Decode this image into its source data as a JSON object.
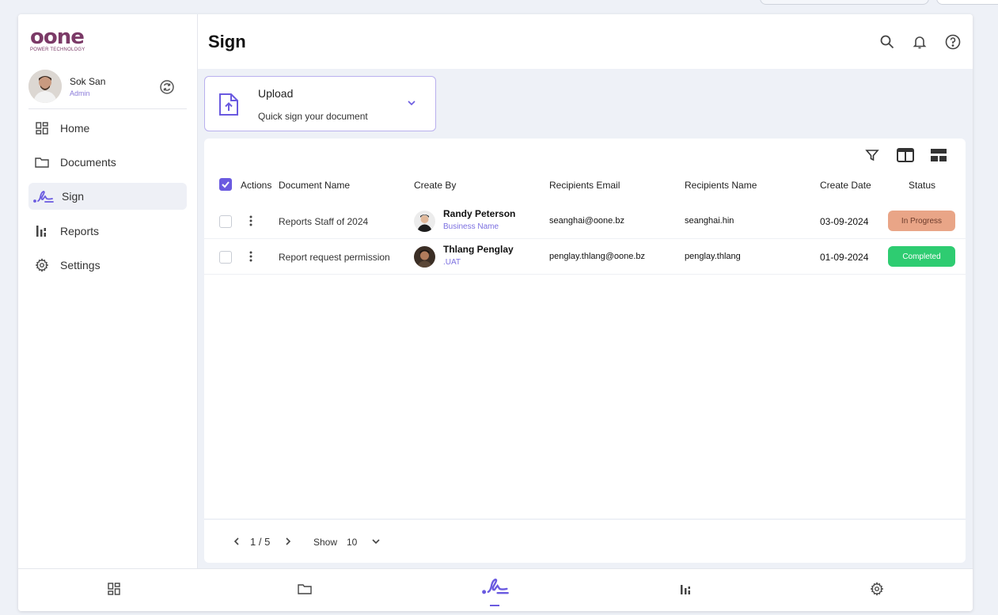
{
  "brand": {
    "logo_text": "oone",
    "tagline": "POWER TECHNOLOGY"
  },
  "user": {
    "name": "Sok San",
    "role": "Admin"
  },
  "sidebar": {
    "items": [
      {
        "label": "Home",
        "icon": "grid-icon"
      },
      {
        "label": "Documents",
        "icon": "folder-icon"
      },
      {
        "label": "Sign",
        "icon": "signature-icon",
        "active": true
      },
      {
        "label": "Reports",
        "icon": "bar-chart-icon"
      },
      {
        "label": "Settings",
        "icon": "gear-icon"
      }
    ]
  },
  "header": {
    "title": "Sign",
    "icons": [
      "search-icon",
      "bell-icon",
      "help-icon"
    ]
  },
  "upload": {
    "title": "Upload",
    "subtitle": "Quick sign your document"
  },
  "table": {
    "columns": [
      "Actions",
      "Document Name",
      "Create By",
      "Recipients Email",
      "Recipients Name",
      "Create Date",
      "Status"
    ],
    "rows": [
      {
        "document": "Reports Staff of 2024",
        "creator": "Randy Peterson",
        "creator_sub": "Business Name",
        "email": "seanghai@oone.bz",
        "recipient": "seanghai.hin",
        "date": "03-09-2024",
        "status": "In Progress"
      },
      {
        "document": "Report request permission",
        "creator": "Thlang Penglay",
        "creator_sub": ".UAT",
        "email": "penglay.thlang@oone.bz",
        "recipient": "penglay.thlang",
        "date": "01-09-2024",
        "status": "Completed"
      }
    ]
  },
  "pagination": {
    "page": "1 / 5",
    "show_label": "Show",
    "show_value": "10"
  },
  "colors": {
    "accent": "#6a5ae0",
    "in_progress": "#e9a587",
    "completed": "#2ecc71",
    "brand": "#7b3a67"
  }
}
